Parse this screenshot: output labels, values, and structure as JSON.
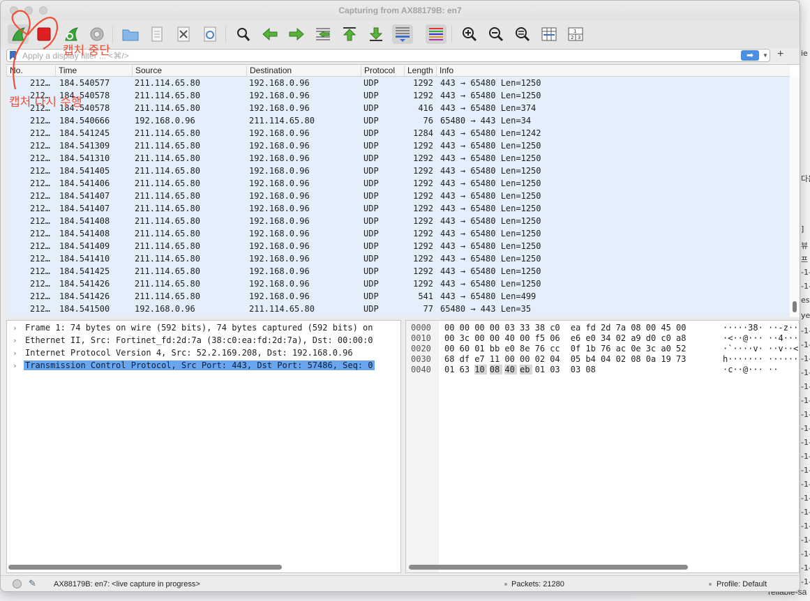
{
  "window": {
    "title": "Capturing from AX88179B: en7"
  },
  "toolbar": {
    "buttons": [
      {
        "name": "start-capture-button",
        "icon": "shark-fin-icon"
      },
      {
        "name": "stop-capture-button",
        "icon": "stop-square-icon"
      },
      {
        "name": "restart-capture-button",
        "icon": "restart-fin-icon"
      },
      {
        "name": "capture-options-button",
        "icon": "gear-icon"
      },
      {
        "name": "open-file-button",
        "icon": "folder-icon"
      },
      {
        "name": "save-file-button",
        "icon": "file-icon"
      },
      {
        "name": "close-file-button",
        "icon": "close-file-icon"
      },
      {
        "name": "reload-file-button",
        "icon": "reload-icon"
      },
      {
        "name": "find-packet-button",
        "icon": "magnifier-icon"
      },
      {
        "name": "go-back-button",
        "icon": "arrow-left-icon"
      },
      {
        "name": "go-forward-button",
        "icon": "arrow-right-icon"
      },
      {
        "name": "go-to-packet-button",
        "icon": "goto-icon"
      },
      {
        "name": "go-first-button",
        "icon": "arrow-up-icon"
      },
      {
        "name": "go-last-button",
        "icon": "arrow-down-icon"
      },
      {
        "name": "autoscroll-button",
        "icon": "autoscroll-icon"
      },
      {
        "name": "colorize-button",
        "icon": "colorize-icon"
      },
      {
        "name": "zoom-in-button",
        "icon": "zoom-in-icon"
      },
      {
        "name": "zoom-out-button",
        "icon": "zoom-out-icon"
      },
      {
        "name": "zoom-normal-button",
        "icon": "zoom-normal-icon"
      },
      {
        "name": "resize-columns-button",
        "icon": "resize-columns-icon"
      },
      {
        "name": "layout-button",
        "icon": "layout-icon"
      }
    ],
    "layout_icon_digits": [
      "1",
      "2",
      "3"
    ]
  },
  "filter": {
    "placeholder": "Apply a display filter ... <⌘/>",
    "value": "",
    "add_label": "+"
  },
  "packet_list": {
    "columns": [
      "No.",
      "Time",
      "Source",
      "Destination",
      "Protocol",
      "Length",
      "Info"
    ],
    "rows": [
      [
        "212…",
        "184.540577",
        "211.114.65.80",
        "192.168.0.96",
        "UDP",
        "1292",
        "443 → 65480 Len=1250"
      ],
      [
        "212…",
        "184.540578",
        "211.114.65.80",
        "192.168.0.96",
        "UDP",
        "1292",
        "443 → 65480 Len=1250"
      ],
      [
        "212…",
        "184.540578",
        "211.114.65.80",
        "192.168.0.96",
        "UDP",
        "416",
        "443 → 65480 Len=374"
      ],
      [
        "212…",
        "184.540666",
        "192.168.0.96",
        "211.114.65.80",
        "UDP",
        "76",
        "65480 → 443 Len=34"
      ],
      [
        "212…",
        "184.541245",
        "211.114.65.80",
        "192.168.0.96",
        "UDP",
        "1284",
        "443 → 65480 Len=1242"
      ],
      [
        "212…",
        "184.541309",
        "211.114.65.80",
        "192.168.0.96",
        "UDP",
        "1292",
        "443 → 65480 Len=1250"
      ],
      [
        "212…",
        "184.541310",
        "211.114.65.80",
        "192.168.0.96",
        "UDP",
        "1292",
        "443 → 65480 Len=1250"
      ],
      [
        "212…",
        "184.541405",
        "211.114.65.80",
        "192.168.0.96",
        "UDP",
        "1292",
        "443 → 65480 Len=1250"
      ],
      [
        "212…",
        "184.541406",
        "211.114.65.80",
        "192.168.0.96",
        "UDP",
        "1292",
        "443 → 65480 Len=1250"
      ],
      [
        "212…",
        "184.541407",
        "211.114.65.80",
        "192.168.0.96",
        "UDP",
        "1292",
        "443 → 65480 Len=1250"
      ],
      [
        "212…",
        "184.541407",
        "211.114.65.80",
        "192.168.0.96",
        "UDP",
        "1292",
        "443 → 65480 Len=1250"
      ],
      [
        "212…",
        "184.541408",
        "211.114.65.80",
        "192.168.0.96",
        "UDP",
        "1292",
        "443 → 65480 Len=1250"
      ],
      [
        "212…",
        "184.541408",
        "211.114.65.80",
        "192.168.0.96",
        "UDP",
        "1292",
        "443 → 65480 Len=1250"
      ],
      [
        "212…",
        "184.541409",
        "211.114.65.80",
        "192.168.0.96",
        "UDP",
        "1292",
        "443 → 65480 Len=1250"
      ],
      [
        "212…",
        "184.541410",
        "211.114.65.80",
        "192.168.0.96",
        "UDP",
        "1292",
        "443 → 65480 Len=1250"
      ],
      [
        "212…",
        "184.541425",
        "211.114.65.80",
        "192.168.0.96",
        "UDP",
        "1292",
        "443 → 65480 Len=1250"
      ],
      [
        "212…",
        "184.541426",
        "211.114.65.80",
        "192.168.0.96",
        "UDP",
        "1292",
        "443 → 65480 Len=1250"
      ],
      [
        "212…",
        "184.541426",
        "211.114.65.80",
        "192.168.0.96",
        "UDP",
        "541",
        "443 → 65480 Len=499"
      ],
      [
        "212…",
        "184.541500",
        "192.168.0.96",
        "211.114.65.80",
        "UDP",
        "77",
        "65480 → 443 Len=35"
      ]
    ]
  },
  "details": {
    "rows": [
      {
        "text": "Frame 1: 74 bytes on wire (592 bits), 74 bytes captured (592 bits) on",
        "selected": false
      },
      {
        "text": "Ethernet II, Src: Fortinet_fd:2d:7a (38:c0:ea:fd:2d:7a), Dst: 00:00:0",
        "selected": false
      },
      {
        "text": "Internet Protocol Version 4, Src: 52.2.169.208, Dst: 192.168.0.96",
        "selected": false
      },
      {
        "text": "Transmission Control Protocol, Src Port: 443, Dst Port: 57486, Seq: 0",
        "selected": true
      }
    ]
  },
  "hex": {
    "rows": [
      {
        "offset": "0000",
        "bytes": [
          "00",
          "00",
          "00",
          "00",
          "03",
          "33",
          "38",
          "c0",
          "ea",
          "fd",
          "2d",
          "7a",
          "08",
          "00",
          "45",
          "00"
        ],
        "ascii": "·····38· ··-z··E·"
      },
      {
        "offset": "0010",
        "bytes": [
          "00",
          "3c",
          "00",
          "00",
          "40",
          "00",
          "f5",
          "06",
          "e6",
          "e0",
          "34",
          "02",
          "a9",
          "d0",
          "c0",
          "a8"
        ],
        "ascii": "·<··@··· ··4·····"
      },
      {
        "offset": "0020",
        "bytes": [
          "00",
          "60",
          "01",
          "bb",
          "e0",
          "8e",
          "76",
          "cc",
          "0f",
          "1b",
          "76",
          "ac",
          "0e",
          "3c",
          "a0",
          "52"
        ],
        "ascii": "·`····v· ··v··<·R"
      },
      {
        "offset": "0030",
        "bytes": [
          "68",
          "df",
          "e7",
          "11",
          "00",
          "00",
          "02",
          "04",
          "05",
          "b4",
          "04",
          "02",
          "08",
          "0a",
          "19",
          "73"
        ],
        "ascii": "h······· ·······s"
      },
      {
        "offset": "0040",
        "bytes": [
          "01",
          "63",
          "10",
          "08",
          "40",
          "eb",
          "01",
          "03",
          "03",
          "08"
        ],
        "ascii": "·c··@··· ··"
      }
    ],
    "highlight_bytes": "0040:2-5"
  },
  "status": {
    "interface": "AX88179B: en7: <live capture in progress>",
    "packets": "Packets: 21280",
    "profile": "Profile: Default"
  },
  "annotations": {
    "stop_label": "캡처 중단",
    "restart_label": "캡처 다시 수행",
    "color": "#ef4f35"
  },
  "background": {
    "right_strip_texts": [
      "ie",
      "다음",
      "]",
      "뷰",
      "프",
      "-1-",
      "-1-",
      "es",
      "yer",
      "-1-",
      "-1-",
      "-1-",
      "-1-",
      "-1-",
      "-1-",
      "-1-",
      "-1-",
      "-1-",
      "-1-",
      "-1-",
      "-1-",
      "-1-",
      "-1-",
      "-1-",
      "-1-",
      "-1-",
      "-1-",
      "-1-",
      "-1-",
      "-1-",
      "-1-",
      "! 화"
    ],
    "bottom_text": "reliable-sa",
    "left_fragments": [
      "A",
      "u",
      "r"
    ]
  },
  "colors": {
    "selected_rows": "#e4effb",
    "selected_tree": "#6aa6ee",
    "accent_blue": "#4a8fe0",
    "stop_red": "#e02020"
  }
}
